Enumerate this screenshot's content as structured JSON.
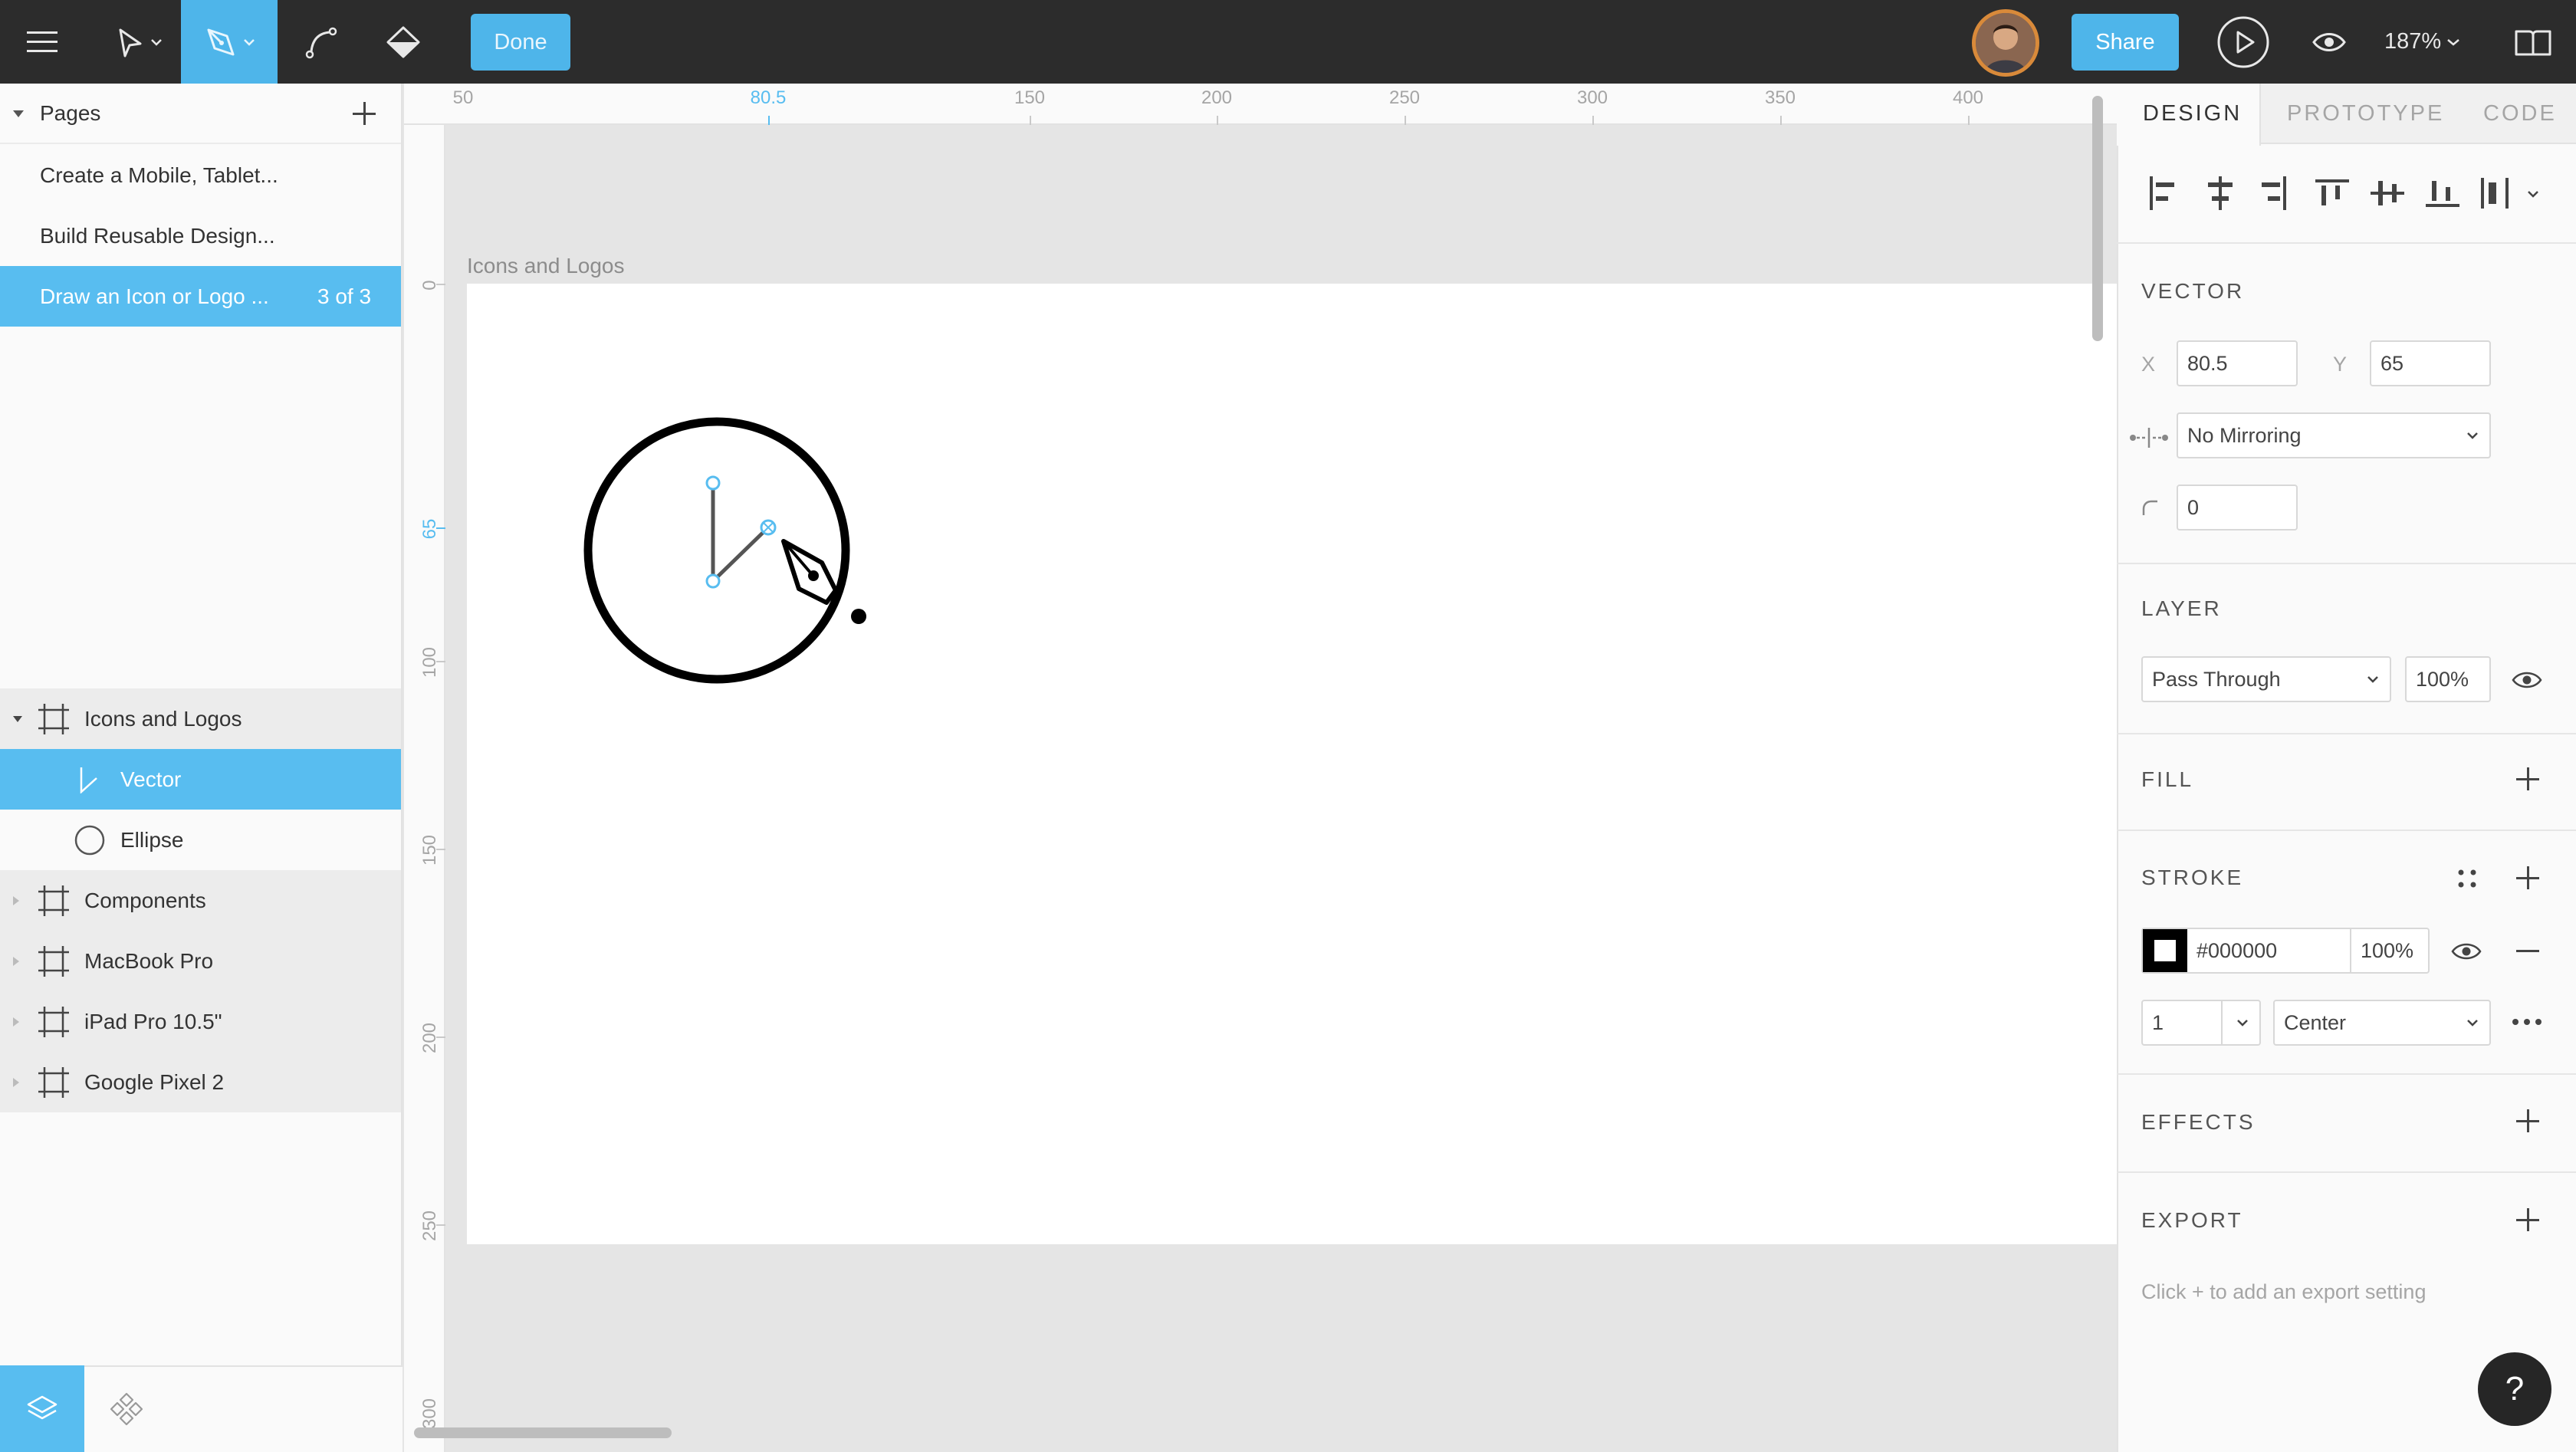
{
  "toolbar": {
    "done_label": "Done",
    "share_label": "Share",
    "zoom": "187%"
  },
  "pages": {
    "header": "Pages",
    "items": [
      {
        "label": "Create a Mobile, Tablet...",
        "count": ""
      },
      {
        "label": "Build Reusable Design...",
        "count": ""
      },
      {
        "label": "Draw an Icon or Logo ...",
        "count": "3 of 3"
      }
    ]
  },
  "layers": [
    {
      "label": "Icons and Logos"
    },
    {
      "label": "Vector"
    },
    {
      "label": "Ellipse"
    },
    {
      "label": "Components"
    },
    {
      "label": "MacBook Pro"
    },
    {
      "label": "iPad Pro 10.5\""
    },
    {
      "label": "Google Pixel 2"
    }
  ],
  "rulers": {
    "top": [
      "50",
      "80.5",
      "150",
      "200",
      "250",
      "300",
      "350",
      "400"
    ],
    "left": [
      "0",
      "65",
      "100",
      "150",
      "200",
      "250",
      "300"
    ]
  },
  "canvas": {
    "frame_label": "Icons and Logos"
  },
  "inspector": {
    "tabs": [
      "DESIGN",
      "PROTOTYPE",
      "CODE"
    ],
    "vector": {
      "title": "VECTOR",
      "x_label": "X",
      "x_value": "80.5",
      "y_label": "Y",
      "y_value": "65",
      "mirroring": "No Mirroring",
      "corner_radius": "0"
    },
    "layer": {
      "title": "LAYER",
      "blend": "Pass Through",
      "opacity": "100%"
    },
    "fill": {
      "title": "FILL"
    },
    "stroke": {
      "title": "STROKE",
      "color_hex": "#000000",
      "color_swatch": "#000000",
      "opacity": "100%",
      "weight": "1",
      "align": "Center"
    },
    "effects": {
      "title": "EFFECTS"
    },
    "export": {
      "title": "EXPORT",
      "hint": "Click + to add an export setting"
    },
    "help": "?"
  },
  "colors": {
    "accent": "#58bdf0",
    "toolbar_bg": "#2c2c2c"
  }
}
